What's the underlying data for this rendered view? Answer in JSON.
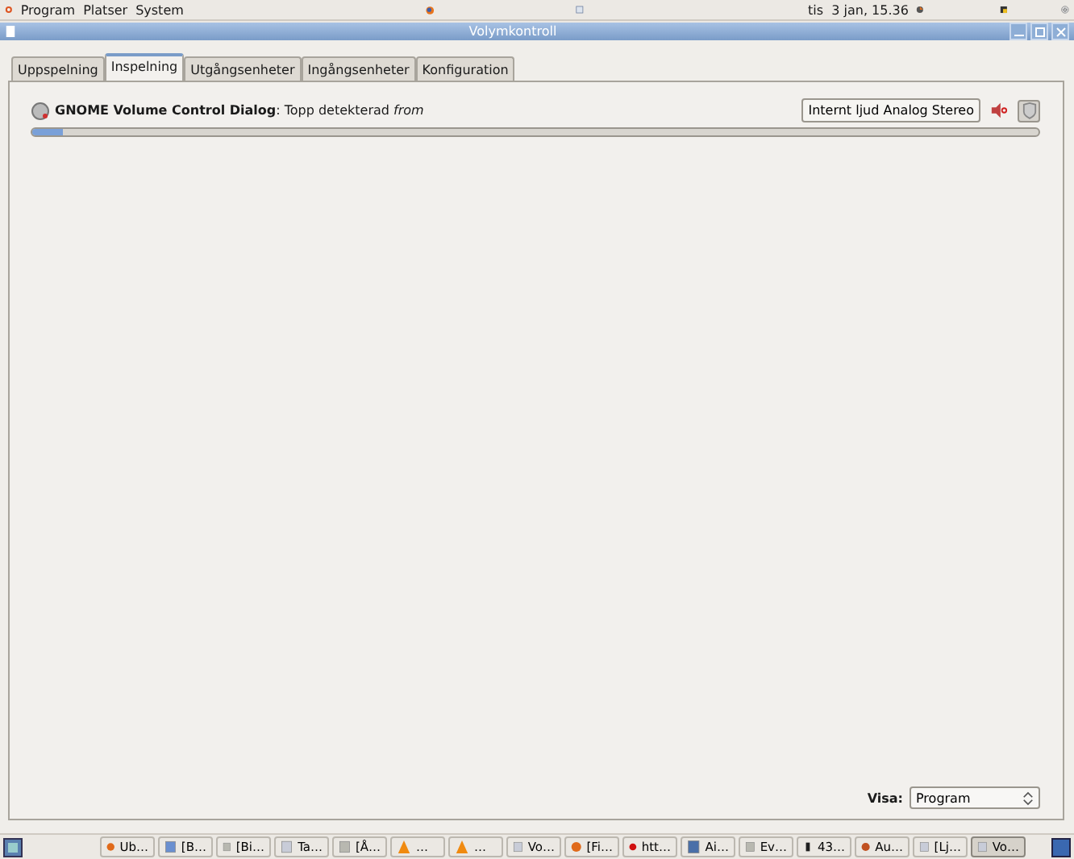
{
  "top_panel": {
    "menus": [
      "Program",
      "Platser",
      "System"
    ],
    "clock": "tis  3 jan, 15.36"
  },
  "window": {
    "title": "Volymkontroll"
  },
  "tabs": [
    {
      "label": "Uppspelning",
      "selected": false
    },
    {
      "label": "Inspelning",
      "selected": true
    },
    {
      "label": "Utgångsenheter",
      "selected": false
    },
    {
      "label": "Ingångsenheter",
      "selected": false
    },
    {
      "label": "Konfiguration",
      "selected": false
    }
  ],
  "streams": [
    {
      "app": "GNOME Volume Control Dialog",
      "separator": ":",
      "description": "Topp detekterad",
      "source": "from",
      "device": "Internt ljud Analog Stereo",
      "muted": false,
      "level": 0.03
    }
  ],
  "show": {
    "label": "Visa:",
    "value": "Program"
  },
  "taskbar": [
    {
      "label": "Ub…",
      "kind": "browser",
      "selected": false
    },
    {
      "label": "[B…",
      "kind": "image",
      "selected": false
    },
    {
      "label": "[Bi…",
      "kind": "file",
      "selected": false
    },
    {
      "label": "Ta…",
      "kind": "doc",
      "selected": false
    },
    {
      "label": "[Å…",
      "kind": "file",
      "selected": false
    },
    {
      "label": "…",
      "kind": "cone",
      "selected": false
    },
    {
      "label": "…",
      "kind": "cone",
      "selected": false
    },
    {
      "label": "Vo…",
      "kind": "doc",
      "selected": false
    },
    {
      "label": "[Fi…",
      "kind": "browser",
      "selected": false
    },
    {
      "label": "htt…",
      "kind": "opera",
      "selected": false
    },
    {
      "label": "Ai…",
      "kind": "window",
      "selected": false
    },
    {
      "label": "Ev…",
      "kind": "file",
      "selected": false
    },
    {
      "label": "43…",
      "kind": "phone",
      "selected": false
    },
    {
      "label": "Au…",
      "kind": "audio",
      "selected": false
    },
    {
      "label": "[Lj…",
      "kind": "doc",
      "selected": false
    },
    {
      "label": "Vo…",
      "kind": "doc",
      "selected": true
    }
  ]
}
